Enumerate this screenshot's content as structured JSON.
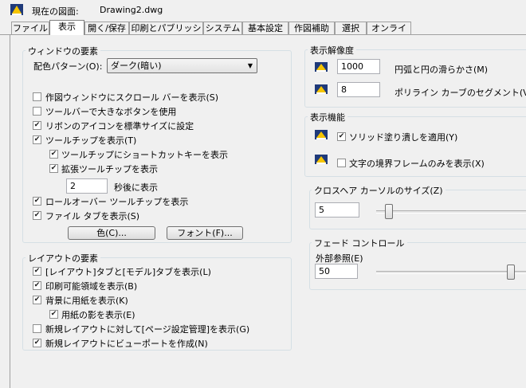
{
  "header": {
    "current_label": "現在の図面:",
    "drawing_name": "Drawing2.dwg"
  },
  "tabs": [
    "ファイル",
    "表示",
    "開く/保存",
    "印刷とパブリッシュ",
    "システム",
    "基本設定",
    "作図補助",
    "選択",
    "オンライン"
  ],
  "active_tab": "表示",
  "window": {
    "title": "ウィンドウの要素",
    "color_scheme_label": "配色パターン(O):",
    "color_scheme_value": "ダーク(暗い)",
    "options": [
      {
        "label": "作図ウィンドウにスクロール バーを表示(S)",
        "checked": false
      },
      {
        "label": "ツールバーで大きなボタンを使用",
        "checked": false
      },
      {
        "label": "リボンのアイコンを標準サイズに設定",
        "checked": true
      },
      {
        "label": "ツールチップを表示(T)",
        "checked": true
      },
      {
        "label": "ツールチップにショートカットキーを表示",
        "checked": true
      },
      {
        "label": "拡張ツールチップを表示",
        "checked": true
      }
    ],
    "delay_value": "2",
    "delay_label": "秒後に表示",
    "rollover_label": "ロールオーバー ツールチップを表示",
    "rollover_checked": true,
    "file_tabs_label": "ファイル タブを表示(S)",
    "file_tabs_checked": true,
    "color_button": "色(C)...",
    "font_button": "フォント(F)..."
  },
  "layout": {
    "title": "レイアウトの要素",
    "options": [
      {
        "label": "[レイアウト]タブと[モデル]タブを表示(L)",
        "checked": true
      },
      {
        "label": "印刷可能領域を表示(B)",
        "checked": true
      },
      {
        "label": "背景に用紙を表示(K)",
        "checked": true
      },
      {
        "label": "用紙の影を表示(E)",
        "checked": true
      },
      {
        "label": "新規レイアウトに対して[ページ設定管理]を表示(G)",
        "checked": false
      },
      {
        "label": "新規レイアウトにビューポートを作成(N)",
        "checked": true
      }
    ]
  },
  "resolution": {
    "title": "表示解像度",
    "arc_value": "1000",
    "arc_label": "円弧と円の滑らかさ(M)",
    "pline_value": "8",
    "pline_label": "ポリライン カーブのセグメント(V)"
  },
  "performance": {
    "title": "表示機能",
    "solid_fill_label": "ソリッド塗り潰しを適用(Y)",
    "solid_fill_checked": true,
    "text_frame_label": "文字の境界フレームのみを表示(X)",
    "text_frame_checked": false
  },
  "crosshair": {
    "title": "クロスヘア カーソルのサイズ(Z)",
    "value": "5",
    "level": 0.05
  },
  "fade": {
    "title": "フェード コントロール",
    "xref_label": "外部参照(E)",
    "value": "50",
    "level": 0.9
  },
  "colors": {
    "icon_yellow": "#f5c400",
    "icon_navy": "#1f3a7a"
  }
}
